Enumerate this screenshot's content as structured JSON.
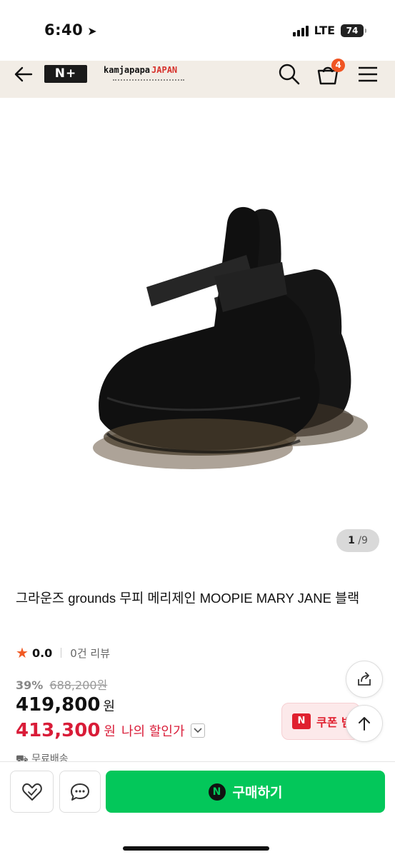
{
  "status": {
    "time": "6:40",
    "network": "LTE",
    "battery": "74"
  },
  "header": {
    "logo_text": "N+",
    "brand_name": "kamjapapa",
    "brand_suffix": "JAPAN",
    "cart_count": "4"
  },
  "image": {
    "counter_current": "1",
    "counter_total": "/9"
  },
  "product": {
    "title": "그라운즈 grounds 무피 메리제인 MOOPIE MARY JANE 블랙",
    "rating": "0.0",
    "reviews": "0건 리뷰",
    "discount_rate": "39%",
    "original_price": "688,200원",
    "price": "419,800",
    "price_unit": "원",
    "my_price": "413,300",
    "my_price_unit": "원",
    "my_price_label": "나의 할인가",
    "shipping": "무료배송"
  },
  "actions": {
    "coupon_label": "쿠폰 받",
    "buy_label": "구매하기",
    "npay_letter": "N"
  },
  "colors": {
    "accent_green": "#03c75a",
    "price_red": "#d91c38",
    "badge_orange": "#f05523",
    "header_bg": "#f2ede6"
  }
}
